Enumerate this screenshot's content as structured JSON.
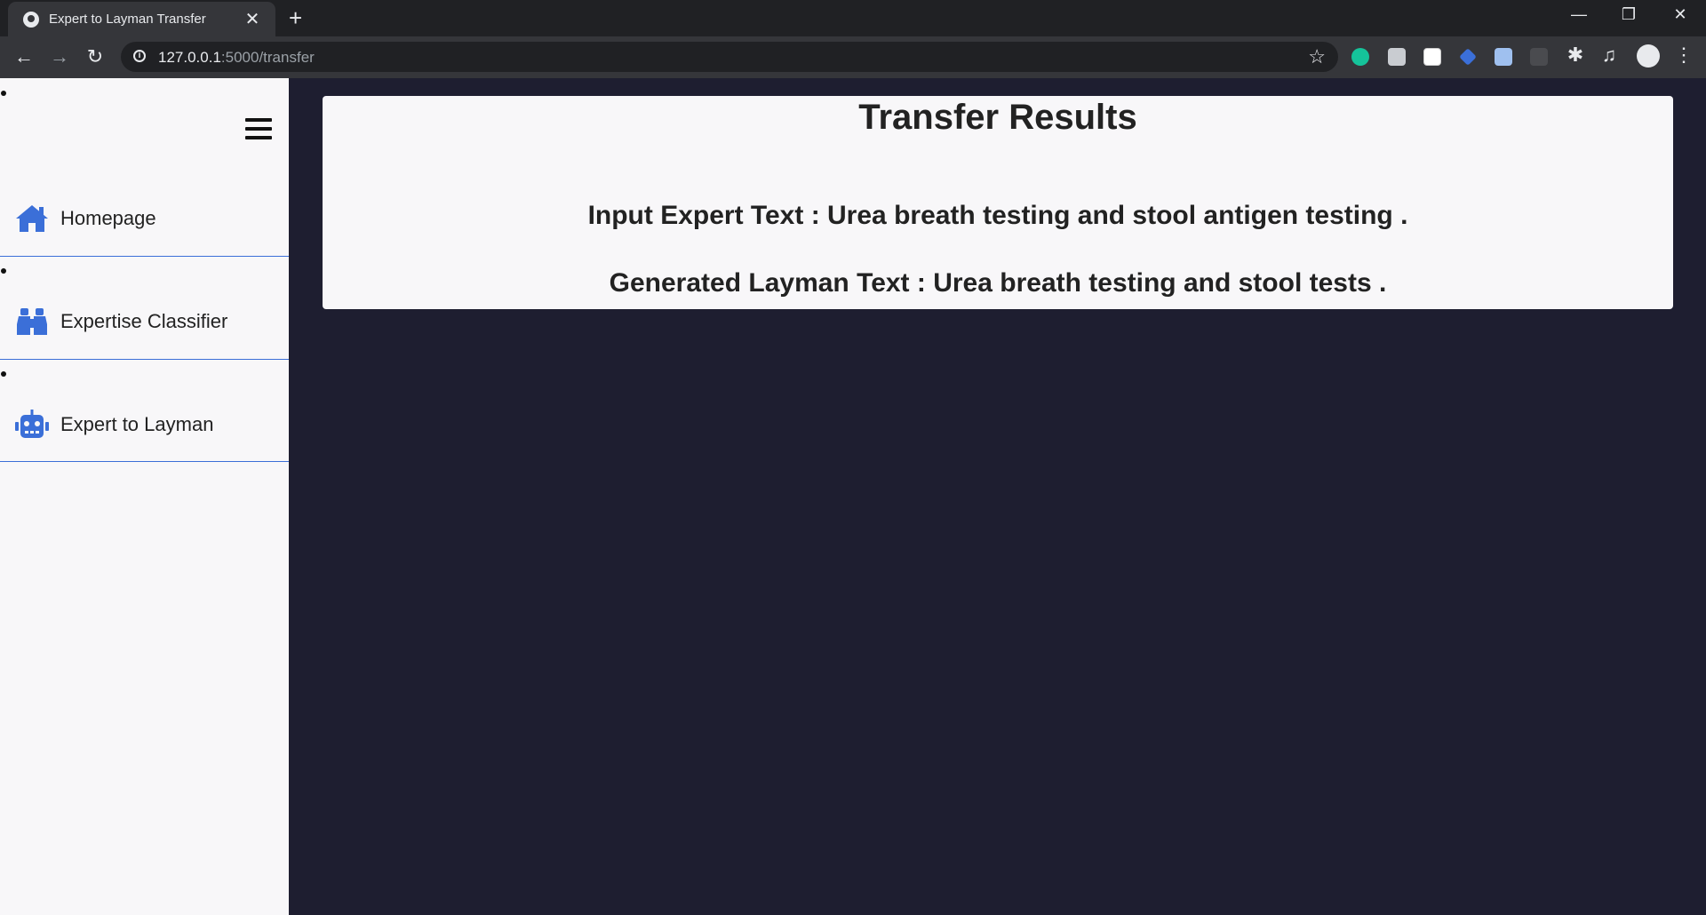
{
  "browser": {
    "tab_title": "Expert to Layman Transfer",
    "tab_close": "✕",
    "new_tab": "+",
    "url_host": "127.0.0.1",
    "url_path": ":5000/transfer"
  },
  "sidebar": {
    "items": [
      {
        "label": "Homepage",
        "icon": "home-icon"
      },
      {
        "label": "Expertise Classifier",
        "icon": "binoculars-icon"
      },
      {
        "label": "Expert to Layman",
        "icon": "robot-icon"
      }
    ]
  },
  "main": {
    "title": "Transfer Results",
    "input_text": "Input Expert Text : Urea breath testing and stool antigen testing .",
    "output_text": "Generated Layman Text : Urea breath testing and stool tests ."
  },
  "colors": {
    "accent": "#3b6fd8",
    "page_bg": "#1e1e30",
    "panel_bg": "#f8f7f9"
  }
}
